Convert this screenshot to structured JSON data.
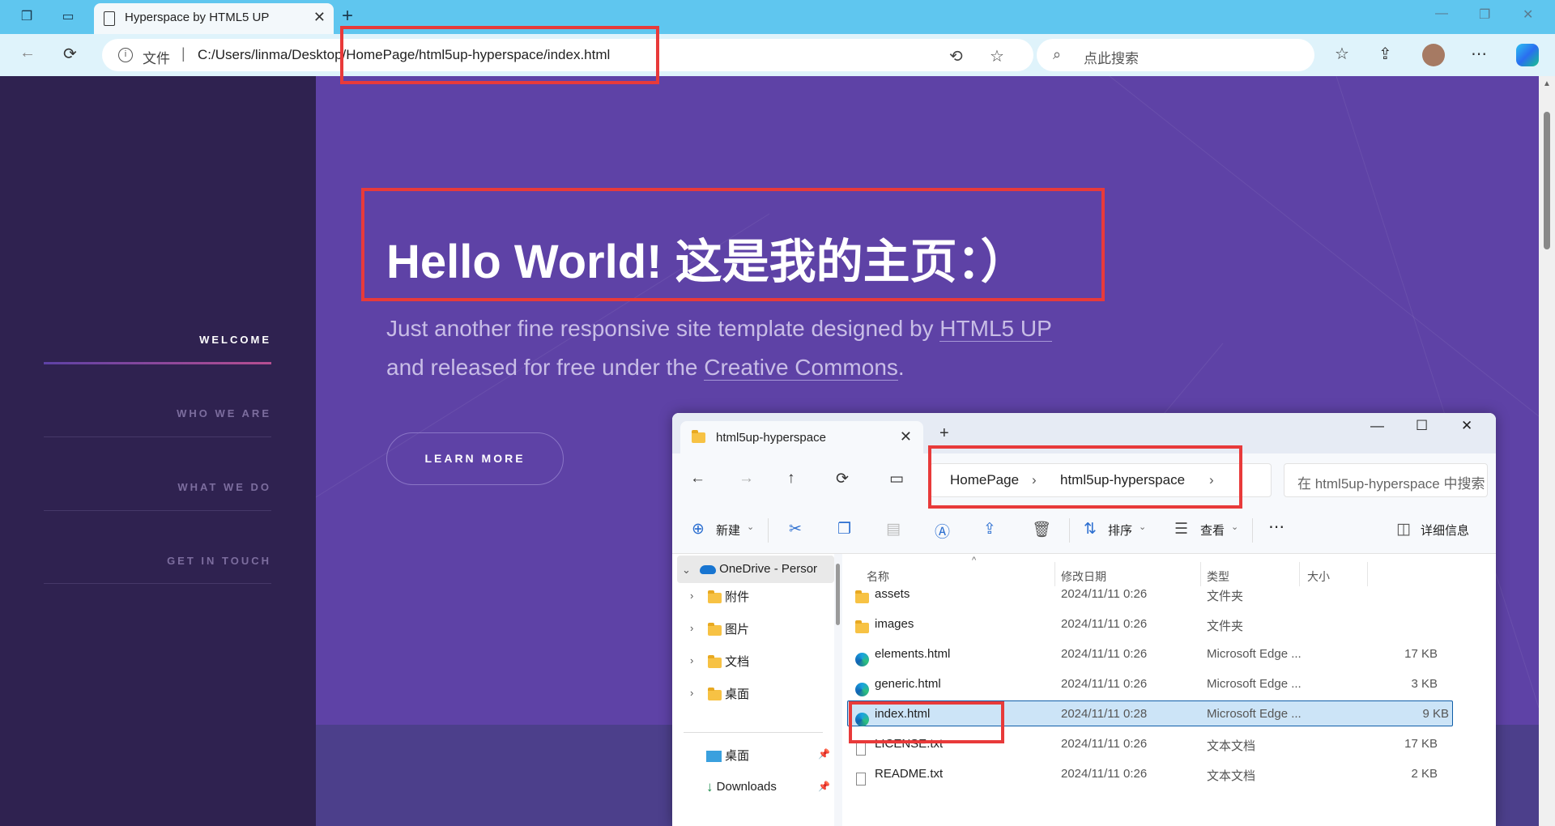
{
  "browser": {
    "tab_title": "Hyperspace by HTML5 UP",
    "file_label": "文件",
    "url": "C:/Users/linma/Desktop/HomePage/html5up-hyperspace/index.html",
    "search_placeholder": "点此搜索"
  },
  "sidebar": {
    "items": [
      {
        "label": "WELCOME",
        "active": true
      },
      {
        "label": "WHO WE ARE",
        "active": false
      },
      {
        "label": "WHAT WE DO",
        "active": false
      },
      {
        "label": "GET IN TOUCH",
        "active": false
      }
    ]
  },
  "hero": {
    "title": "Hello World! 这是我的主页：）",
    "line1_text": "Just another fine responsive site template designed by ",
    "line1_link": "HTML5 UP",
    "line2_text": "and released for free under the ",
    "line2_link": "Creative Commons",
    "line2_end": ".",
    "button": "LEARN MORE"
  },
  "explorer": {
    "tab_title": "html5up-hyperspace",
    "breadcrumb": [
      "HomePage",
      "html5up-hyperspace"
    ],
    "search_placeholder": "在 html5up-hyperspace 中搜索",
    "toolbar": {
      "new": "新建",
      "sort": "排序",
      "view": "查看",
      "details": "详细信息"
    },
    "nav_tree": {
      "root": "OneDrive - Persor",
      "children": [
        "附件",
        "图片",
        "文档",
        "桌面"
      ],
      "quick": [
        "桌面",
        "Downloads"
      ]
    },
    "columns": [
      "名称",
      "修改日期",
      "类型",
      "大小"
    ],
    "files": [
      {
        "name": "assets",
        "date": "2024/11/11 0:26",
        "type": "文件夹",
        "size": "",
        "icon": "folder-icon"
      },
      {
        "name": "images",
        "date": "2024/11/11 0:26",
        "type": "文件夹",
        "size": "",
        "icon": "folder-icon"
      },
      {
        "name": "elements.html",
        "date": "2024/11/11 0:26",
        "type": "Microsoft Edge ...",
        "size": "17 KB",
        "icon": "edge-icon"
      },
      {
        "name": "generic.html",
        "date": "2024/11/11 0:26",
        "type": "Microsoft Edge ...",
        "size": "3 KB",
        "icon": "edge-icon"
      },
      {
        "name": "index.html",
        "date": "2024/11/11 0:28",
        "type": "Microsoft Edge ...",
        "size": "9 KB",
        "icon": "edge-icon",
        "selected": true
      },
      {
        "name": "LICENSE.txt",
        "date": "2024/11/11 0:26",
        "type": "文本文档",
        "size": "17 KB",
        "icon": "text-file-icon"
      },
      {
        "name": "README.txt",
        "date": "2024/11/11 0:26",
        "type": "文本文档",
        "size": "2 KB",
        "icon": "text-file-icon"
      }
    ]
  },
  "colors": {
    "accent": "#5e42a6",
    "sidebar": "#2f2250",
    "highlight_box": "#e83a3a",
    "browser_chrome": "#5fc6ef"
  }
}
